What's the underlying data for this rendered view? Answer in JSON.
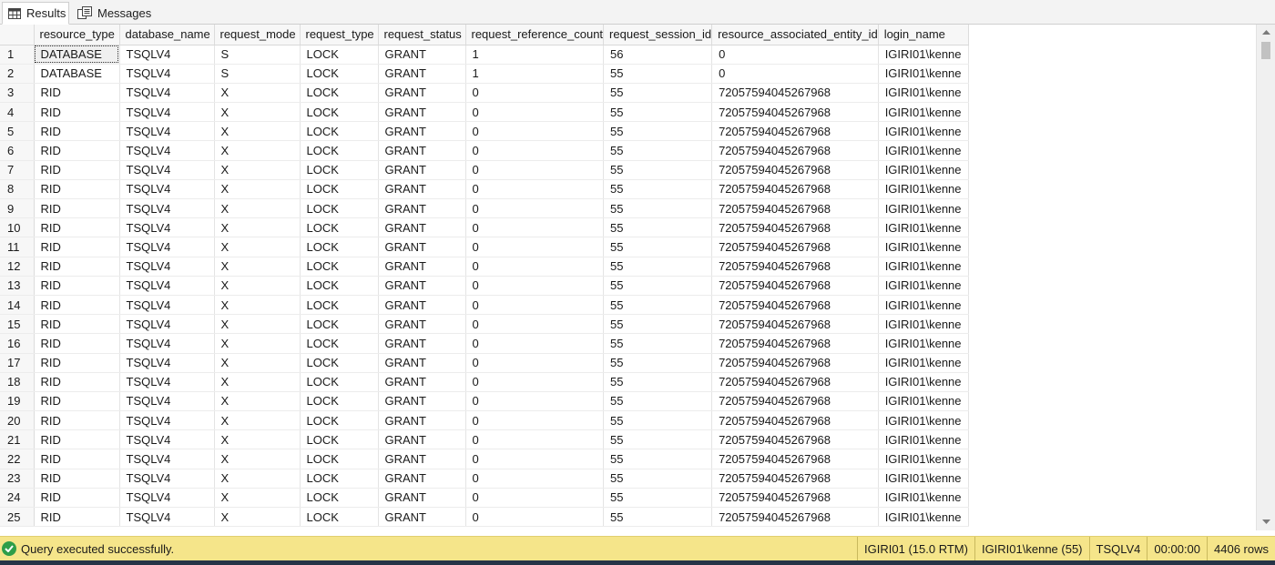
{
  "tabs": [
    {
      "label": "Results",
      "icon": "grid-icon",
      "active": true
    },
    {
      "label": "Messages",
      "icon": "messages-icon",
      "active": false
    }
  ],
  "grid": {
    "columns": [
      "resource_type",
      "database_name",
      "request_mode",
      "request_type",
      "request_status",
      "request_reference_count",
      "request_session_id",
      "resource_associated_entity_id",
      "login_name"
    ],
    "rows": [
      [
        "1",
        "DATABASE",
        "TSQLV4",
        "S",
        "LOCK",
        "GRANT",
        "1",
        "56",
        "0",
        "IGIRI01\\kenne"
      ],
      [
        "2",
        "DATABASE",
        "TSQLV4",
        "S",
        "LOCK",
        "GRANT",
        "1",
        "55",
        "0",
        "IGIRI01\\kenne"
      ],
      [
        "3",
        "RID",
        "TSQLV4",
        "X",
        "LOCK",
        "GRANT",
        "0",
        "55",
        "72057594045267968",
        "IGIRI01\\kenne"
      ],
      [
        "4",
        "RID",
        "TSQLV4",
        "X",
        "LOCK",
        "GRANT",
        "0",
        "55",
        "72057594045267968",
        "IGIRI01\\kenne"
      ],
      [
        "5",
        "RID",
        "TSQLV4",
        "X",
        "LOCK",
        "GRANT",
        "0",
        "55",
        "72057594045267968",
        "IGIRI01\\kenne"
      ],
      [
        "6",
        "RID",
        "TSQLV4",
        "X",
        "LOCK",
        "GRANT",
        "0",
        "55",
        "72057594045267968",
        "IGIRI01\\kenne"
      ],
      [
        "7",
        "RID",
        "TSQLV4",
        "X",
        "LOCK",
        "GRANT",
        "0",
        "55",
        "72057594045267968",
        "IGIRI01\\kenne"
      ],
      [
        "8",
        "RID",
        "TSQLV4",
        "X",
        "LOCK",
        "GRANT",
        "0",
        "55",
        "72057594045267968",
        "IGIRI01\\kenne"
      ],
      [
        "9",
        "RID",
        "TSQLV4",
        "X",
        "LOCK",
        "GRANT",
        "0",
        "55",
        "72057594045267968",
        "IGIRI01\\kenne"
      ],
      [
        "10",
        "RID",
        "TSQLV4",
        "X",
        "LOCK",
        "GRANT",
        "0",
        "55",
        "72057594045267968",
        "IGIRI01\\kenne"
      ],
      [
        "11",
        "RID",
        "TSQLV4",
        "X",
        "LOCK",
        "GRANT",
        "0",
        "55",
        "72057594045267968",
        "IGIRI01\\kenne"
      ],
      [
        "12",
        "RID",
        "TSQLV4",
        "X",
        "LOCK",
        "GRANT",
        "0",
        "55",
        "72057594045267968",
        "IGIRI01\\kenne"
      ],
      [
        "13",
        "RID",
        "TSQLV4",
        "X",
        "LOCK",
        "GRANT",
        "0",
        "55",
        "72057594045267968",
        "IGIRI01\\kenne"
      ],
      [
        "14",
        "RID",
        "TSQLV4",
        "X",
        "LOCK",
        "GRANT",
        "0",
        "55",
        "72057594045267968",
        "IGIRI01\\kenne"
      ],
      [
        "15",
        "RID",
        "TSQLV4",
        "X",
        "LOCK",
        "GRANT",
        "0",
        "55",
        "72057594045267968",
        "IGIRI01\\kenne"
      ],
      [
        "16",
        "RID",
        "TSQLV4",
        "X",
        "LOCK",
        "GRANT",
        "0",
        "55",
        "72057594045267968",
        "IGIRI01\\kenne"
      ],
      [
        "17",
        "RID",
        "TSQLV4",
        "X",
        "LOCK",
        "GRANT",
        "0",
        "55",
        "72057594045267968",
        "IGIRI01\\kenne"
      ],
      [
        "18",
        "RID",
        "TSQLV4",
        "X",
        "LOCK",
        "GRANT",
        "0",
        "55",
        "72057594045267968",
        "IGIRI01\\kenne"
      ],
      [
        "19",
        "RID",
        "TSQLV4",
        "X",
        "LOCK",
        "GRANT",
        "0",
        "55",
        "72057594045267968",
        "IGIRI01\\kenne"
      ],
      [
        "20",
        "RID",
        "TSQLV4",
        "X",
        "LOCK",
        "GRANT",
        "0",
        "55",
        "72057594045267968",
        "IGIRI01\\kenne"
      ],
      [
        "21",
        "RID",
        "TSQLV4",
        "X",
        "LOCK",
        "GRANT",
        "0",
        "55",
        "72057594045267968",
        "IGIRI01\\kenne"
      ],
      [
        "22",
        "RID",
        "TSQLV4",
        "X",
        "LOCK",
        "GRANT",
        "0",
        "55",
        "72057594045267968",
        "IGIRI01\\kenne"
      ],
      [
        "23",
        "RID",
        "TSQLV4",
        "X",
        "LOCK",
        "GRANT",
        "0",
        "55",
        "72057594045267968",
        "IGIRI01\\kenne"
      ],
      [
        "24",
        "RID",
        "TSQLV4",
        "X",
        "LOCK",
        "GRANT",
        "0",
        "55",
        "72057594045267968",
        "IGIRI01\\kenne"
      ],
      [
        "25",
        "RID",
        "TSQLV4",
        "X",
        "LOCK",
        "GRANT",
        "0",
        "55",
        "72057594045267968",
        "IGIRI01\\kenne"
      ]
    ]
  },
  "status": {
    "message": "Query executed successfully.",
    "server": "IGIRI01 (15.0 RTM)",
    "login": "IGIRI01\\kenne (55)",
    "database": "TSQLV4",
    "elapsed": "00:00:00",
    "rows": "4406 rows",
    "icon": "check-circle-icon",
    "bar_color": "#f5e58a"
  }
}
